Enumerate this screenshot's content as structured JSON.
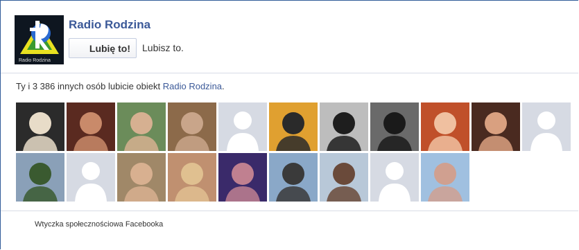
{
  "page": {
    "name": "Radio Rodzina",
    "logo_text": "Radio Rodzina"
  },
  "like_button": {
    "label": "Lubię to!",
    "status": "Lubisz to."
  },
  "summary": {
    "prefix": "Ty i 3 386 innych osób lubicie obiekt ",
    "link": "Radio Rodzina",
    "suffix": "."
  },
  "faces": [
    {
      "type": "photo",
      "bg": "#2b2b2b",
      "fg": "#e8dcc8"
    },
    {
      "type": "photo",
      "bg": "#5a2a20",
      "fg": "#c98a6a"
    },
    {
      "type": "photo",
      "bg": "#6b8c5a",
      "fg": "#d6b091"
    },
    {
      "type": "photo",
      "bg": "#8c6a4a",
      "fg": "#c9a58a"
    },
    {
      "type": "default"
    },
    {
      "type": "photo",
      "bg": "#e0a030",
      "fg": "#2a2a2a"
    },
    {
      "type": "photo",
      "bg": "#bdbdbd",
      "fg": "#1e1e1e"
    },
    {
      "type": "photo",
      "bg": "#6a6a6a",
      "fg": "#1a1a1a"
    },
    {
      "type": "photo",
      "bg": "#c0502a",
      "fg": "#f0c0a0"
    },
    {
      "type": "photo",
      "bg": "#4a2a20",
      "fg": "#d9a080"
    },
    {
      "type": "default"
    },
    {
      "type": "photo",
      "bg": "#8aa0b8",
      "fg": "#3a5a30"
    },
    {
      "type": "default"
    },
    {
      "type": "photo",
      "bg": "#a08868",
      "fg": "#d8b090"
    },
    {
      "type": "photo",
      "bg": "#c09070",
      "fg": "#e0c090"
    },
    {
      "type": "photo",
      "bg": "#3a2a6a",
      "fg": "#c08090"
    },
    {
      "type": "photo",
      "bg": "#8aa8c8",
      "fg": "#3a3a3a"
    },
    {
      "type": "photo",
      "bg": "#b8c8d8",
      "fg": "#6a4a3a"
    },
    {
      "type": "default"
    },
    {
      "type": "photo",
      "bg": "#a0c0e0",
      "fg": "#d0a090"
    }
  ],
  "footer": {
    "text": "Wtyczka społecznościowa Facebooka"
  },
  "colors": {
    "link": "#3b5998",
    "border": "#315c99",
    "divider": "#d8dce6",
    "default_avatar": "#d6dae3"
  }
}
